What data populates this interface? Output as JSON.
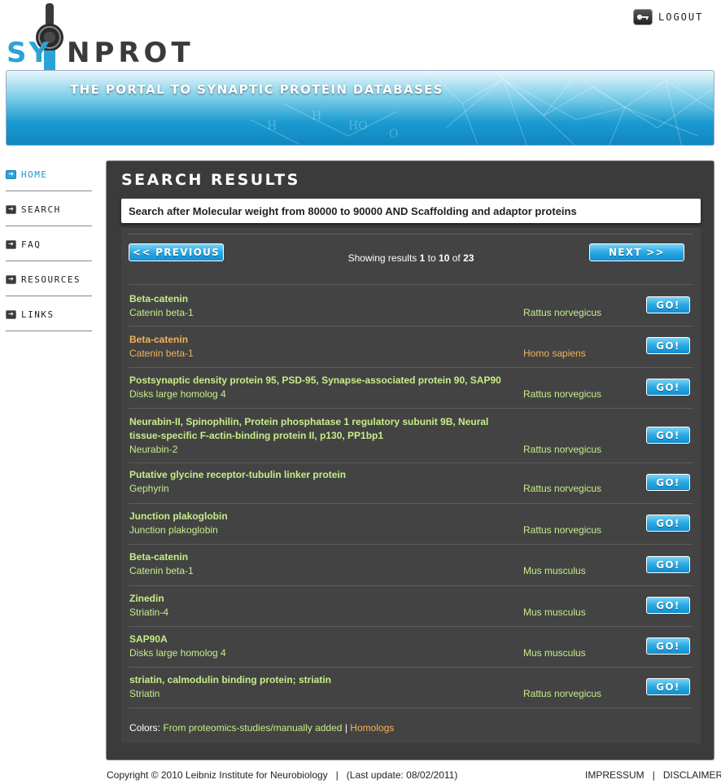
{
  "header": {
    "logo_text_1": "SY",
    "logo_text_2": "NPROT",
    "logout_label": "LOGOUT",
    "tagline": "THE PORTAL TO SYNAPTIC PROTEIN DATABASES"
  },
  "nav": {
    "items": [
      {
        "label": "HOME",
        "icon": "arrow-right-icon",
        "active": true
      },
      {
        "label": "SEARCH",
        "icon": "arrow-right-icon",
        "active": false
      },
      {
        "label": "FAQ",
        "icon": "arrow-right-icon",
        "active": false
      },
      {
        "label": "RESOURCES",
        "icon": "arrow-right-icon",
        "active": false
      },
      {
        "label": "LINKS",
        "icon": "arrow-right-icon",
        "active": false
      }
    ]
  },
  "main": {
    "title": "SEARCH RESULTS",
    "query": "Search after Molecular weight from 80000 to 90000 AND Scaffolding and adaptor proteins",
    "pager": {
      "prev_label": "<< PREVIOUS",
      "next_label": "NEXT >>",
      "showing_prefix": "Showing results",
      "from": "1",
      "to_word": "to",
      "to": "10",
      "of_word": "of",
      "total": "23"
    },
    "go_label": "GO!",
    "results": [
      {
        "title": "Beta-catenin",
        "subtitle": "Catenin beta-1",
        "species": "Rattus norvegicus",
        "homolog": false
      },
      {
        "title": "Beta-catenin",
        "subtitle": "Catenin beta-1",
        "species": "Homo sapiens",
        "homolog": true
      },
      {
        "title": "Postsynaptic density protein 95, PSD-95, Synapse-associated protein 90, SAP90",
        "subtitle": "Disks large homolog 4",
        "species": "Rattus norvegicus",
        "homolog": false
      },
      {
        "title": "Neurabin-II, Spinophilin, Protein phosphatase 1 regulatory subunit 9B, Neural tissue-specific F-actin-binding protein II, p130, PP1bp1",
        "subtitle": "Neurabin-2",
        "species": "Rattus norvegicus",
        "homolog": false
      },
      {
        "title": "Putative glycine receptor-tubulin linker protein",
        "subtitle": "Gephyrin",
        "species": "Rattus norvegicus",
        "homolog": false
      },
      {
        "title": "Junction plakoglobin",
        "subtitle": "Junction plakoglobin",
        "species": "Rattus norvegicus",
        "homolog": false
      },
      {
        "title": "Beta-catenin",
        "subtitle": "Catenin beta-1",
        "species": "Mus musculus",
        "homolog": false
      },
      {
        "title": "Zinedin",
        "subtitle": "Striatin-4",
        "species": "Mus musculus",
        "homolog": false
      },
      {
        "title": "SAP90A",
        "subtitle": "Disks large homolog 4",
        "species": "Mus musculus",
        "homolog": false
      },
      {
        "title": "striatin, calmodulin binding protein; striatin",
        "subtitle": "Striatin",
        "species": "Rattus norvegicus",
        "homolog": false
      }
    ],
    "colors_legend": {
      "label": "Colors:",
      "item1": "From proteomics-studies/manually added",
      "separator": "|",
      "item2": "Homologs"
    }
  },
  "footer": {
    "copyright": "Copyright © 2010 Leibniz Institute for Neurobiology   |   (Last update: 08/02/2011)",
    "impressum": "IMPRESSUM",
    "separator": "|",
    "disclaimer": "DISCLAIMER"
  },
  "colors": {
    "accent_blue": "#1a95cf",
    "panel_dark": "#3b3b3b",
    "result_green": "#c5ee8a",
    "homolog_orange": "#f2b35a"
  }
}
